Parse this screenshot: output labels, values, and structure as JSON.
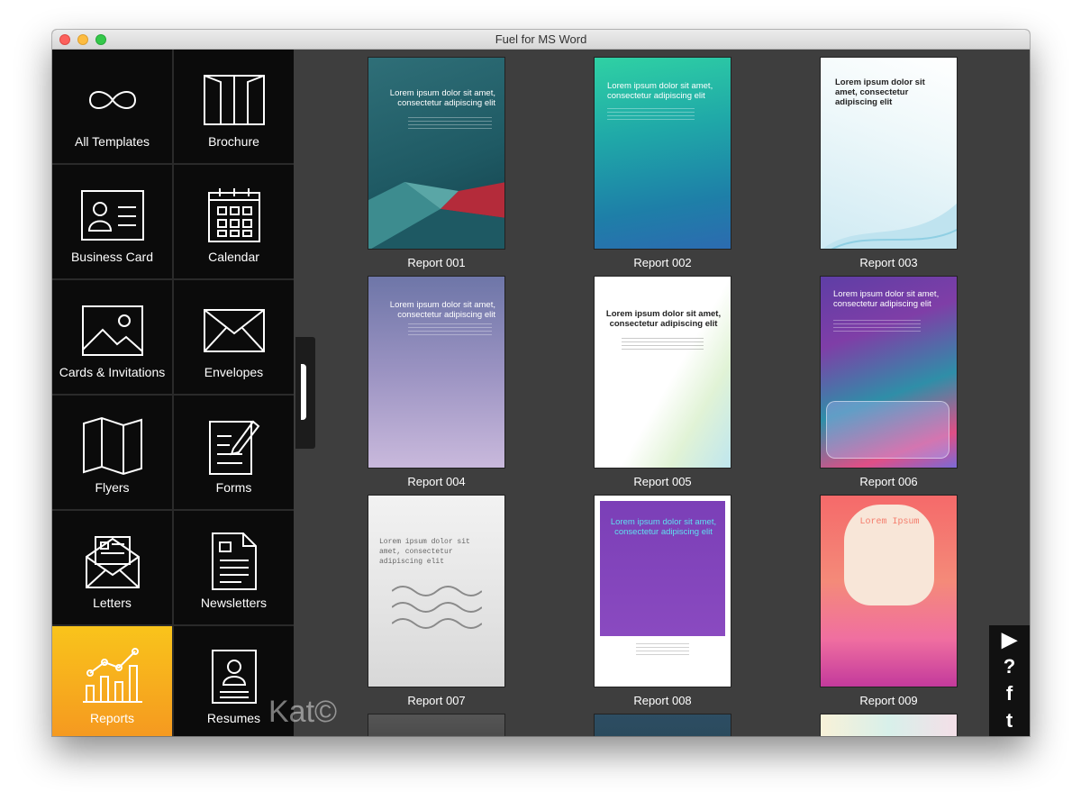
{
  "window": {
    "title": "Fuel for MS Word"
  },
  "sidebar": {
    "items": [
      {
        "label": "All Templates",
        "icon": "infinity-icon"
      },
      {
        "label": "Brochure",
        "icon": "book-icon"
      },
      {
        "label": "Business Card",
        "icon": "business-card-icon"
      },
      {
        "label": "Calendar",
        "icon": "calendar-icon"
      },
      {
        "label": "Cards & Invitations",
        "icon": "image-card-icon"
      },
      {
        "label": "Envelopes",
        "icon": "envelope-icon"
      },
      {
        "label": "Flyers",
        "icon": "folded-map-icon"
      },
      {
        "label": "Forms",
        "icon": "form-edit-icon"
      },
      {
        "label": "Letters",
        "icon": "letter-icon"
      },
      {
        "label": "Newsletters",
        "icon": "newsletter-icon"
      },
      {
        "label": "Reports",
        "icon": "chart-icon",
        "active": true
      },
      {
        "label": "Resumes",
        "icon": "resume-icon"
      }
    ],
    "active_color": "#f7a81e"
  },
  "watermark": "Kat©",
  "templates": [
    {
      "name": "Report 001",
      "heading": "Lorem ipsum dolor sit amet, consectetur adipiscing elit"
    },
    {
      "name": "Report 002",
      "heading": "Lorem ipsum dolor sit amet, consectetur adipiscing elit"
    },
    {
      "name": "Report 003",
      "heading": "Lorem ipsum dolor sit amet, consectetur adipiscing elit"
    },
    {
      "name": "Report 004",
      "heading": "Lorem ipsum dolor sit amet, consectetur adipiscing elit"
    },
    {
      "name": "Report 005",
      "heading": "Lorem ipsum dolor sit amet, consectetur adipiscing elit"
    },
    {
      "name": "Report 006",
      "heading": "Lorem ipsum dolor sit amet, consectetur adipiscing elit"
    },
    {
      "name": "Report 007",
      "heading": "Lorem ipsum dolor sit amet, consectetur adipiscing elit"
    },
    {
      "name": "Report 008",
      "heading": "Lorem ipsum dolor sit amet, consectetur adipiscing elit"
    },
    {
      "name": "Report 009",
      "heading": "Lorem Ipsum"
    }
  ],
  "side_actions": [
    {
      "name": "play-icon",
      "glyph": "▶"
    },
    {
      "name": "help-icon",
      "glyph": "?"
    },
    {
      "name": "facebook-icon",
      "glyph": "f"
    },
    {
      "name": "twitter-icon",
      "glyph": "t"
    }
  ]
}
